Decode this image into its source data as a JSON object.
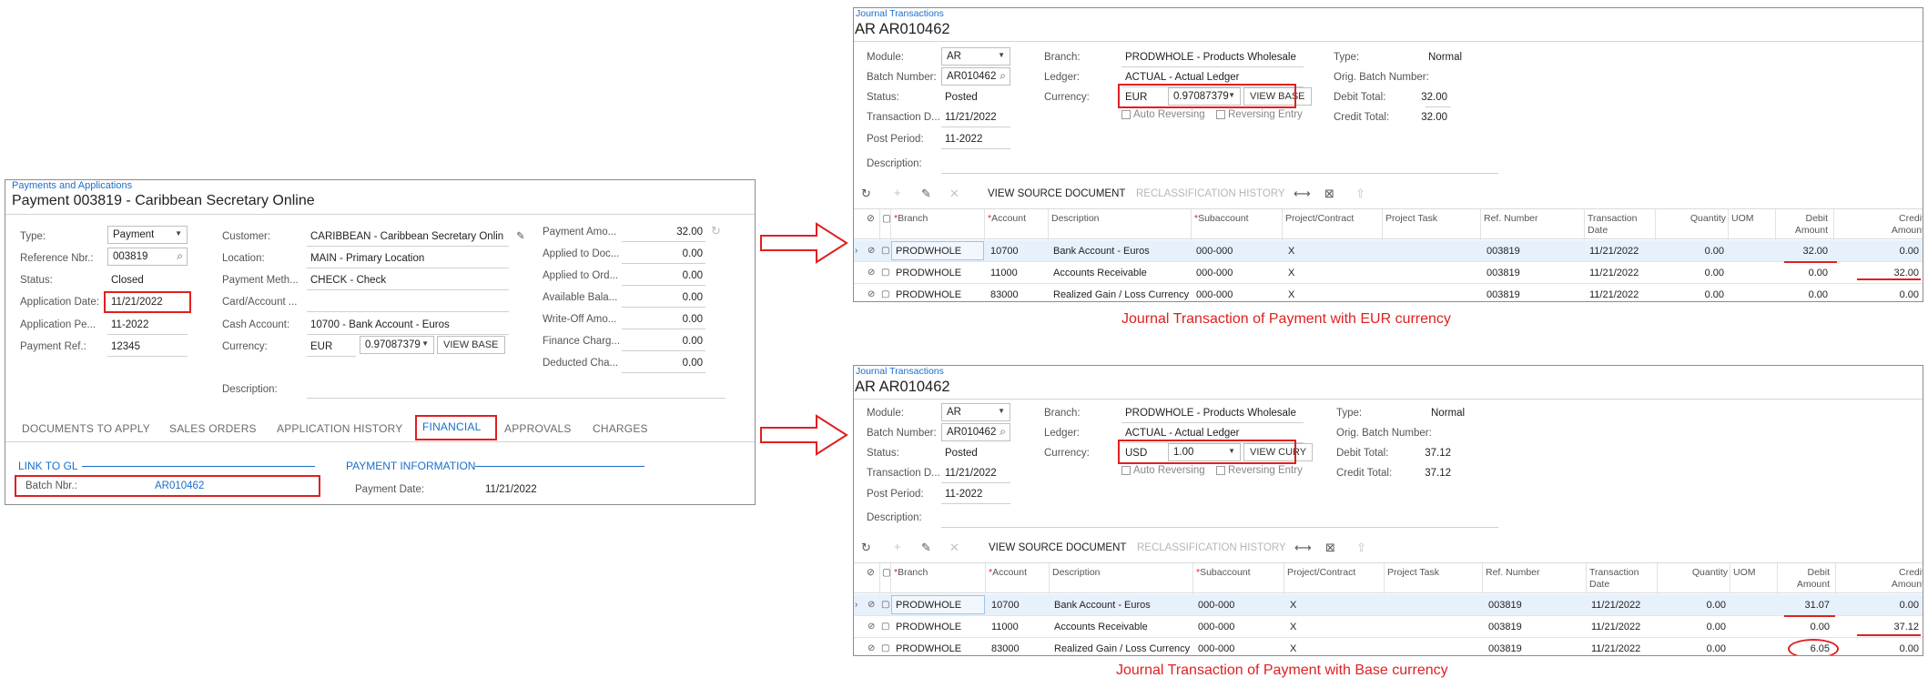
{
  "payment": {
    "breadcrumb": "Payments and Applications",
    "title": "Payment 003819 - Caribbean Secretary Online",
    "labels": {
      "type": "Type:",
      "ref": "Reference Nbr.:",
      "status": "Status:",
      "appdate": "Application Date:",
      "appper": "Application Pe...",
      "payref": "Payment Ref.:",
      "customer": "Customer:",
      "location": "Location:",
      "paymeth": "Payment Meth...",
      "cardacct": "Card/Account ...",
      "cashacct": "Cash Account:",
      "currency": "Currency:",
      "description": "Description:",
      "payamt": "Payment Amo...",
      "appdoc": "Applied to Doc...",
      "appord": "Applied to Ord...",
      "avail": "Available Bala...",
      "writeoff": "Write-Off Amo...",
      "finchg": "Finance Charg...",
      "deducted": "Deducted Cha..."
    },
    "values": {
      "type": "Payment",
      "ref": "003819",
      "status": "Closed",
      "appdate": "11/21/2022",
      "appper": "11-2022",
      "payref": "12345",
      "customer": "CARIBBEAN - Caribbean Secretary Onlin",
      "location": "MAIN - Primary Location",
      "paymeth": "CHECK - Check",
      "cashacct": "10700 - Bank Account - Euros",
      "currency": "EUR",
      "rate": "0.97087379",
      "viewbase": "VIEW BASE",
      "payamt": "32.00",
      "appdoc": "0.00",
      "appord": "0.00",
      "avail": "0.00",
      "writeoff": "0.00",
      "finchg": "0.00",
      "deducted": "0.00"
    },
    "tabs": [
      "DOCUMENTS TO APPLY",
      "SALES ORDERS",
      "APPLICATION HISTORY",
      "FINANCIAL",
      "APPROVALS",
      "CHARGES"
    ],
    "link_gl": "LINK TO GL",
    "batch_label": "Batch Nbr.:",
    "batch_value": "AR010462",
    "payinfo": "PAYMENT INFORMATION",
    "paydate_label": "Payment Date:",
    "paydate_value": "11/21/2022"
  },
  "common": {
    "breadcrumb": "Journal Transactions",
    "title": "AR AR010462",
    "labels": {
      "module": "Module:",
      "batch": "Batch Number:",
      "status": "Status:",
      "trandate": "Transaction D...",
      "postper": "Post Period:",
      "description": "Description:",
      "branch": "Branch:",
      "ledger": "Ledger:",
      "currency": "Currency:",
      "autorev": "Auto Reversing",
      "revent": "Reversing Entry",
      "type": "Type:",
      "origbatch": "Orig. Batch Number:",
      "debit": "Debit Total:",
      "credit": "Credit Total:"
    },
    "values": {
      "module": "AR",
      "batch": "AR010462",
      "status": "Posted",
      "trandate": "11/21/2022",
      "postper": "11-2022",
      "branch": "PRODWHOLE - Products Wholesale",
      "ledger": "ACTUAL - Actual Ledger",
      "type": "Normal"
    },
    "toolbar": {
      "viewsrc": "VIEW SOURCE DOCUMENT",
      "reclass": "RECLASSIFICATION HISTORY"
    },
    "headers": {
      "branch": "Branch",
      "account": "Account",
      "description": "Description",
      "subaccount": "Subaccount",
      "project": "Project/Contract",
      "task": "Project Task",
      "refnbr": "Ref. Number",
      "trandate1": "Transaction",
      "trandate2": "Date",
      "qty": "Quantity",
      "uom": "UOM",
      "debit1": "Debit",
      "debit2": "Amount",
      "credit1": "Credit",
      "credit2": "Amount"
    }
  },
  "eur": {
    "currency": "EUR",
    "rate": "0.97087379",
    "view": "VIEW BASE",
    "debit_total": "32.00",
    "credit_total": "32.00",
    "rows": [
      {
        "branch": "PRODWHOLE",
        "account": "10700",
        "description": "Bank Account - Euros",
        "sub": "000-000",
        "project": "X",
        "ref": "003819",
        "date": "11/21/2022",
        "qty": "0.00",
        "debit": "32.00",
        "credit": "0.00"
      },
      {
        "branch": "PRODWHOLE",
        "account": "11000",
        "description": "Accounts Receivable",
        "sub": "000-000",
        "project": "X",
        "ref": "003819",
        "date": "11/21/2022",
        "qty": "0.00",
        "debit": "0.00",
        "credit": "32.00"
      },
      {
        "branch": "PRODWHOLE",
        "account": "83000",
        "description": "Realized Gain / Loss Currency",
        "sub": "000-000",
        "project": "X",
        "ref": "003819",
        "date": "11/21/2022",
        "qty": "0.00",
        "debit": "0.00",
        "credit": "0.00"
      }
    ],
    "caption": "Journal Transaction of Payment with EUR currency"
  },
  "usd": {
    "currency": "USD",
    "rate": "1.00",
    "view": "VIEW CURY",
    "debit_total": "37.12",
    "credit_total": "37.12",
    "rows": [
      {
        "branch": "PRODWHOLE",
        "account": "10700",
        "description": "Bank Account - Euros",
        "sub": "000-000",
        "project": "X",
        "ref": "003819",
        "date": "11/21/2022",
        "qty": "0.00",
        "debit": "31.07",
        "credit": "0.00"
      },
      {
        "branch": "PRODWHOLE",
        "account": "11000",
        "description": "Accounts Receivable",
        "sub": "000-000",
        "project": "X",
        "ref": "003819",
        "date": "11/21/2022",
        "qty": "0.00",
        "debit": "0.00",
        "credit": "37.12"
      },
      {
        "branch": "PRODWHOLE",
        "account": "83000",
        "description": "Realized Gain / Loss Currency",
        "sub": "000-000",
        "project": "X",
        "ref": "003819",
        "date": "11/21/2022",
        "qty": "0.00",
        "debit": "6.05",
        "credit": "0.00"
      }
    ],
    "caption": "Journal Transaction of Payment with Base currency"
  },
  "colors": {
    "accent": "#1a6fc9",
    "annotation": "#e02020",
    "selected_row": "#e7f1fb"
  }
}
